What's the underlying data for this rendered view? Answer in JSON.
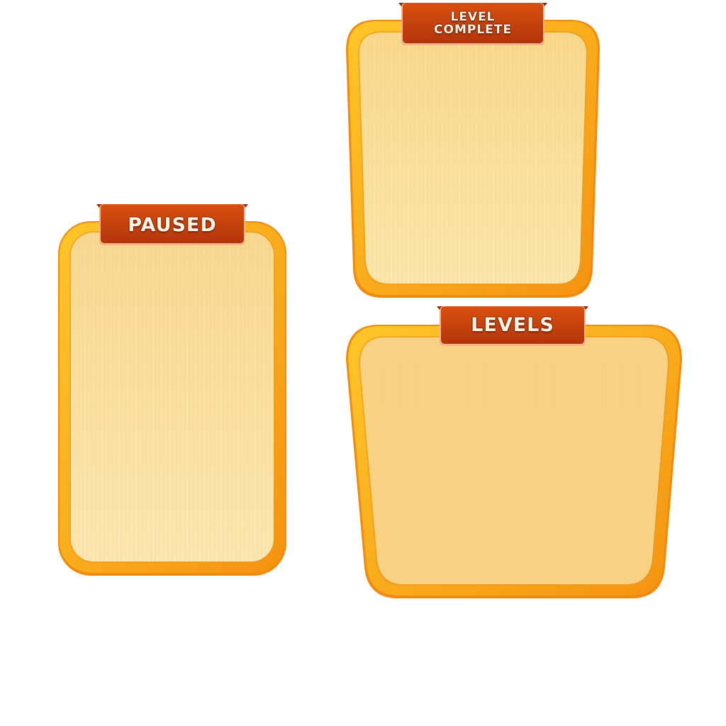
{
  "screens": {
    "paused": {
      "title": "PAUSED"
    },
    "level_complete": {
      "title": "LEVEL\nCOMPLETE"
    },
    "levels": {
      "title": "LEVELS"
    }
  },
  "colors": {
    "frame_outer": "#f59a0c",
    "frame_mid": "#fdbb1e",
    "frame_rim": "#f08a10",
    "paper_light": "#fbe6ad",
    "paper_dark": "#f8d88c",
    "levels_fill": "#f8d184",
    "ribbon_dark": "#b8380c",
    "ribbon_mid": "#d4480f",
    "ribbon_fold": "#8e2a07",
    "ribbon_border": "#f3b48a"
  }
}
